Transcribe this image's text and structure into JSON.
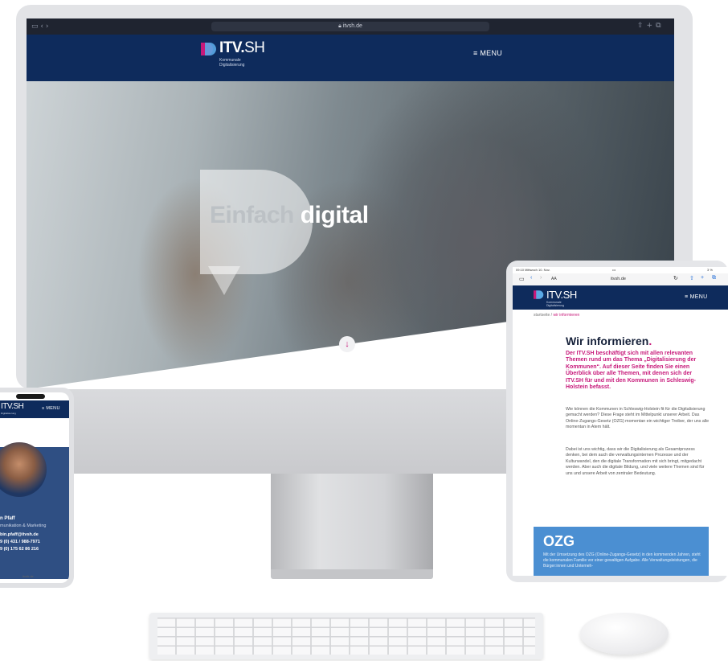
{
  "desktop": {
    "browser_url": "itvsh.de",
    "brand": {
      "logo_bold": "ITV.",
      "logo_light": "SH",
      "logo_sub_line1": "Kommunale",
      "logo_sub_line2": "Digitalisierung"
    },
    "menu_label": "≡ MENU",
    "hero": {
      "word1": "Einfach",
      "word2": "digital"
    },
    "scroll_icon": "↓"
  },
  "tablet": {
    "status_left": "09:10 Mittwoch 10. Nov.",
    "status_dots": "•••",
    "status_right": "3 %",
    "toolbar_aa": "AA",
    "url": "itvsh.de",
    "brand": {
      "logo_bold": "ITV.",
      "logo_light": "SH",
      "logo_sub_line1": "Kommunale",
      "logo_sub_line2": "Digitalisierung"
    },
    "menu_label": "≡ MENU",
    "breadcrumb": {
      "home": "startseite",
      "separator": " / ",
      "current": "wir informieren"
    },
    "heading": "Wir informieren",
    "heading_dot": ".",
    "lead": "Der ITV.SH beschäftigt sich mit allen relevanten Themen rund um das Thema „Digitalisierung der Kommunen“. Auf dieser Seite finden Sie einen Überblick über alle Themen, mit denen sich der ITV.SH für und mit den Kommunen in Schleswig-Holstein befasst.",
    "paragraph1": "Wie können die Kommunen in Schleswig-Holstein fit für die Digitalisierung gemacht werden? Diese Frage steht im Mittelpunkt unserer Arbeit. Das Online-Zugangs-Gesetz (OZG) momentan ein wichtiger Treiber, der uns alle momentan in Atem hält.",
    "paragraph2": "Dabei ist uns wichtig, dass wir die Digitalisierung als Gesamtprozess denken, bei dem auch die verwaltungsinternen Prozesse und der Kulturwandel, den die digitale Transformation mit sich bringt, mitgedacht werden. Aber auch die digitale Bildung, und viele weitere Themen sind für uns und unsere Arbeit von zentraler Bedeutung.",
    "ozg": {
      "title": "OZG",
      "text": "Mit der Umsetzung des OZG (Online-Zugangs-Gesetz) in den kommenden Jahren, steht die kommunalen Familie vor einer gewaltigen Aufgabe. Alle Verwaltungsleistungen, die Bürger:innen und Unterneh-"
    }
  },
  "phone": {
    "brand": {
      "logo_bold": "ITV.",
      "logo_light": "SH",
      "logo_sub_line2": "Digitalisierung"
    },
    "menu_label": "≡ MENU",
    "name": "n Pfaff",
    "role": "munikation & Marketing",
    "email": "bin.pfaff@itvsh.de",
    "phone1": "9 (0) 431 / 988-7971",
    "phone2": "9 (0) 175 62 86 216",
    "url": "itvsh.de"
  },
  "colors": {
    "navy": "#0e2b5c",
    "magenta": "#c7197a",
    "ozg_blue": "#4b8fd2"
  },
  "icons": [
    "logo-d-icon",
    "menu-icon",
    "arrow-down-icon",
    "lock-icon",
    "sidebar-icon",
    "back-icon",
    "forward-icon",
    "share-icon",
    "plus-icon",
    "tabs-icon",
    "reload-icon"
  ]
}
